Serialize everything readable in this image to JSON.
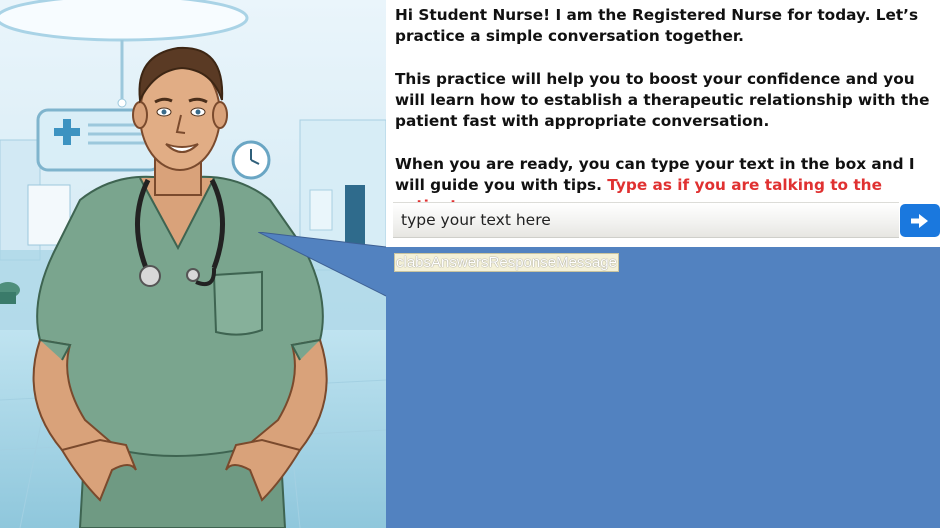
{
  "instructions": {
    "paragraph_1": "Hi Student Nurse! I am the Registered Nurse for today. Let’s practice a simple conversation together.",
    "paragraph_2": "This practice will help you to boost your confidence and you will learn how to establish a therapeutic relationship with the patient fast with appropriate conversation.",
    "paragraph_3_lead": "When you are ready, you can type your text in the box and I will guide you with tips.",
    "paragraph_3_emphasis": "Type as if you are talking to the patient."
  },
  "chat_input": {
    "placeholder": "type your text here",
    "value": ""
  },
  "send_button": {
    "icon": "arrow-right-icon"
  },
  "response": {
    "message": "clabsAnswersResponseMessage"
  },
  "colors": {
    "panel_blue": "#5282c0",
    "send_blue": "#1a78de",
    "emphasis_red": "#e03131",
    "scrubs_green": "#7aa58e"
  }
}
